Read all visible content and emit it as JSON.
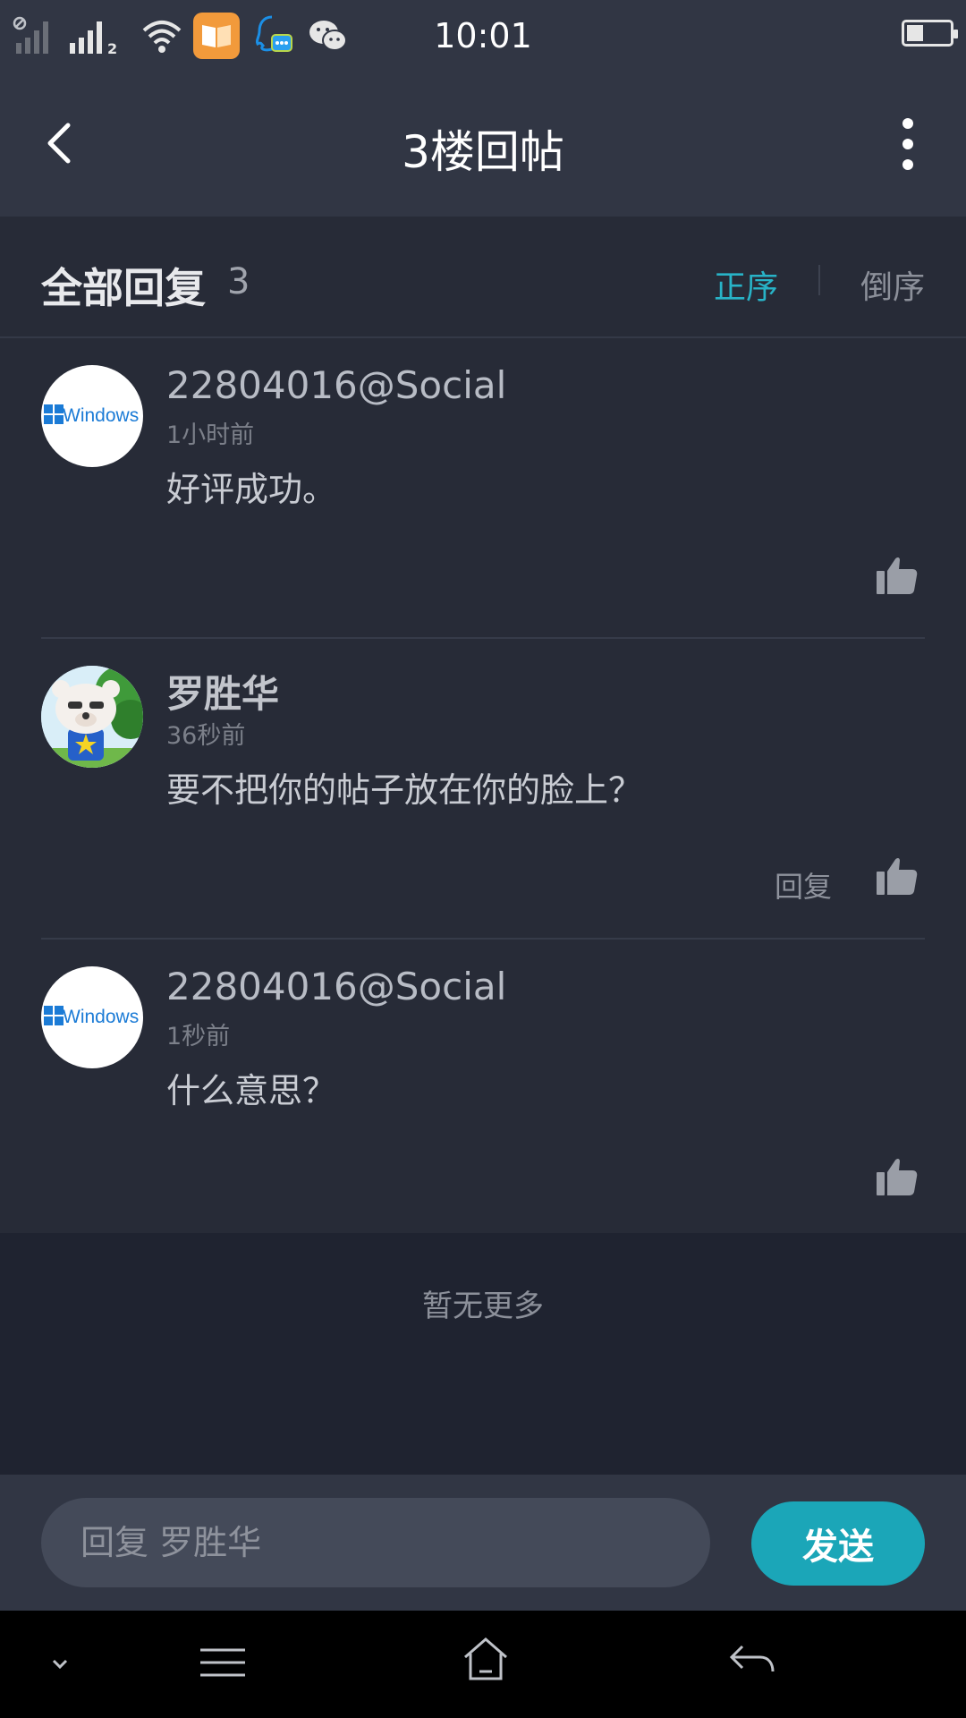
{
  "status_bar": {
    "time": "10:01",
    "sim_slot": "2",
    "icons": [
      "signal-off-icon",
      "signal-icon",
      "wifi-icon",
      "reader-app-icon",
      "qq-icon",
      "wechat-icon",
      "battery-icon"
    ]
  },
  "header": {
    "title": "3楼回帖",
    "back_icon": "back-arrow-icon",
    "more_icon": "more-vertical-icon"
  },
  "replies_header": {
    "title": "全部回复",
    "count": "3",
    "sort_asc": "正序",
    "sort_desc": "倒序",
    "active_sort_color": "#28b3c7"
  },
  "replies": [
    {
      "username": "22804016@Social",
      "time": "1小时前",
      "content": "好评成功。",
      "avatar": "windows-avatar",
      "avatar_text": "Windows",
      "reply_label": ""
    },
    {
      "username": "罗胜华",
      "time": "36秒前",
      "content": "要不把你的帖子放在你的脸上？",
      "avatar": "cartoon-bear-avatar",
      "reply_label": "回复"
    },
    {
      "username": "22804016@Social",
      "time": "1秒前",
      "content": "什么意思？",
      "avatar": "windows-avatar",
      "avatar_text": "Windows",
      "reply_label": ""
    }
  ],
  "footer": {
    "no_more": "暂无更多"
  },
  "reply_bar": {
    "placeholder": "回复 罗胜华",
    "send_label": "发送",
    "accent": "#1ba6b8"
  },
  "nav_bar": {
    "icons": [
      "collapse-icon",
      "menu-icon",
      "home-icon",
      "back-icon"
    ]
  }
}
